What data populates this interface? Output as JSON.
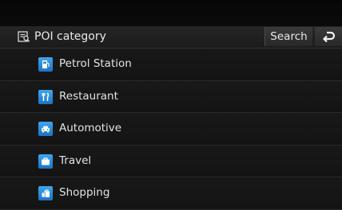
{
  "header": {
    "title": "POI category",
    "icon": "poi-category-icon",
    "search_label": "Search",
    "back_icon": "back-arrow-icon"
  },
  "categories": [
    {
      "label": "Petrol Station",
      "icon": "fuel-pump-icon"
    },
    {
      "label": "Restaurant",
      "icon": "fork-knife-icon"
    },
    {
      "label": "Automotive",
      "icon": "car-icon"
    },
    {
      "label": "Travel",
      "icon": "suitcase-icon"
    },
    {
      "label": "Shopping",
      "icon": "shopping-bag-icon"
    }
  ],
  "colors": {
    "accent": "#2e8fde",
    "background": "#141414",
    "header": "#222222"
  }
}
